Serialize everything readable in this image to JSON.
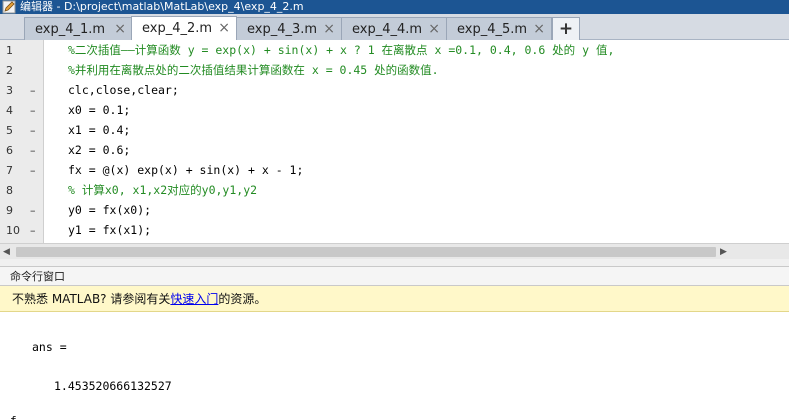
{
  "window": {
    "title": "编辑器 - D:\\project\\matlab\\MatLab\\exp_4\\exp_4_2.m"
  },
  "tabs": [
    {
      "label": "exp_4_1.m",
      "active": false
    },
    {
      "label": "exp_4_2.m",
      "active": true
    },
    {
      "label": "exp_4_3.m",
      "active": false
    },
    {
      "label": "exp_4_4.m",
      "active": false
    },
    {
      "label": "exp_4_5.m",
      "active": false
    }
  ],
  "tab_close_glyph": "×",
  "add_tab_glyph": "+",
  "editor": {
    "lines": [
      {
        "num": "1",
        "dash": "",
        "text": "%二次插值——计算函数 y = exp(x) + sin(x) + x ? 1 在离散点 x =0.1, 0.4, 0.6 处的 y 值,",
        "comment": true
      },
      {
        "num": "2",
        "dash": "",
        "text": "%并利用在离散点处的二次插值结果计算函数在 x = 0.45 处的函数值.",
        "comment": true
      },
      {
        "num": "3",
        "dash": "–",
        "text": "clc,close,clear;",
        "comment": false
      },
      {
        "num": "4",
        "dash": "–",
        "text": "x0 = 0.1;",
        "comment": false
      },
      {
        "num": "5",
        "dash": "–",
        "text": "x1 = 0.4;",
        "comment": false
      },
      {
        "num": "6",
        "dash": "–",
        "text": "x2 = 0.6;",
        "comment": false
      },
      {
        "num": "7",
        "dash": "–",
        "text": "fx = @(x) exp(x) + sin(x) + x - 1;",
        "comment": false
      },
      {
        "num": "8",
        "dash": "",
        "text": "% 计算x0, x1,x2对应的y0,y1,y2",
        "comment": true
      },
      {
        "num": "9",
        "dash": "–",
        "text": "y0 = fx(x0);",
        "comment": false
      },
      {
        "num": "10",
        "dash": "–",
        "text": "y1 = fx(x1);",
        "comment": false
      }
    ]
  },
  "command_window": {
    "title": "命令行窗口",
    "notice_prefix": "不熟悉 MATLAB? 请参阅有关",
    "notice_link": "快速入门",
    "notice_suffix": "的资源。",
    "output_label": "ans =",
    "output_value": "1.453520666132527",
    "prompt_glyph": "f"
  },
  "colors": {
    "titlebar": "#1c5593",
    "comment": "#228b22",
    "notice_bg": "#fff8c9",
    "link": "#0000ee"
  }
}
